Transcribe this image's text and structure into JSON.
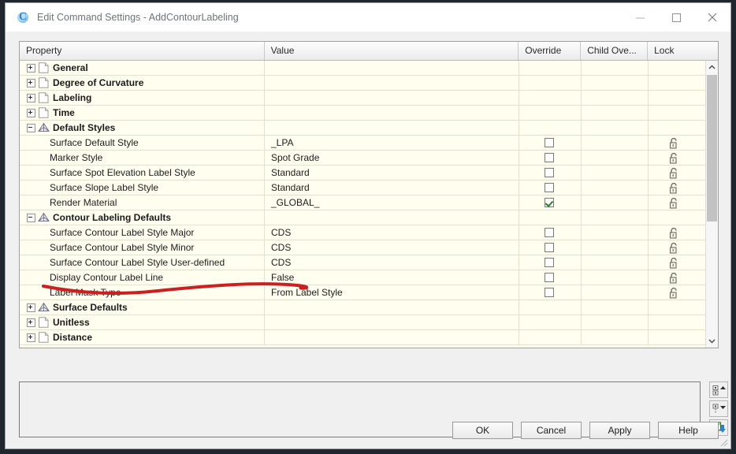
{
  "window": {
    "title": "Edit Command Settings - AddContourLabeling",
    "app_icon": "civil3d-icon",
    "minimize_label": "Minimize",
    "maximize_label": "Maximize",
    "close_label": "Close"
  },
  "grid": {
    "columns": [
      "Property",
      "Value",
      "Override",
      "Child Ove...",
      "Lock"
    ],
    "rows": [
      {
        "property": "General",
        "value": "",
        "type": "group",
        "expanded": false,
        "icon": "page-icon",
        "override": null,
        "lock": false
      },
      {
        "property": "Degree of Curvature",
        "value": "",
        "type": "group",
        "expanded": false,
        "icon": "page-icon",
        "override": null,
        "lock": false
      },
      {
        "property": "Labeling",
        "value": "",
        "type": "group",
        "expanded": false,
        "icon": "page-icon",
        "override": null,
        "lock": false
      },
      {
        "property": "Time",
        "value": "",
        "type": "group",
        "expanded": false,
        "icon": "page-icon",
        "override": null,
        "lock": false
      },
      {
        "property": "Default Styles",
        "value": "",
        "type": "group",
        "expanded": true,
        "icon": "surface-icon",
        "override": null,
        "lock": false
      },
      {
        "property": "Surface Default Style",
        "value": "_LPA",
        "type": "leaf",
        "override": false,
        "lock": true
      },
      {
        "property": "Marker Style",
        "value": "Spot Grade",
        "type": "leaf",
        "override": false,
        "lock": true
      },
      {
        "property": "Surface Spot Elevation Label Style",
        "value": "Standard",
        "type": "leaf",
        "override": false,
        "lock": true
      },
      {
        "property": "Surface Slope Label Style",
        "value": "Standard",
        "type": "leaf",
        "override": false,
        "lock": true
      },
      {
        "property": "Render Material",
        "value": "_GLOBAL_",
        "type": "leaf",
        "override": true,
        "lock": true
      },
      {
        "property": "Contour Labeling Defaults",
        "value": "",
        "type": "group",
        "expanded": true,
        "icon": "surface-icon",
        "override": null,
        "lock": false
      },
      {
        "property": "Surface Contour Label Style Major",
        "value": "CDS",
        "type": "leaf",
        "override": false,
        "lock": true
      },
      {
        "property": "Surface Contour Label Style Minor",
        "value": "CDS",
        "type": "leaf",
        "override": false,
        "lock": true
      },
      {
        "property": "Surface Contour Label Style User-defined",
        "value": "CDS",
        "type": "leaf",
        "override": false,
        "lock": true
      },
      {
        "property": "Display Contour Label Line",
        "value": "False",
        "type": "leaf",
        "override": false,
        "lock": true
      },
      {
        "property": "Label Mask Type",
        "value": "From Label Style",
        "type": "leaf",
        "override": false,
        "lock": true
      },
      {
        "property": "Surface Defaults",
        "value": "",
        "type": "group",
        "expanded": false,
        "icon": "surface-icon",
        "override": null,
        "lock": false
      },
      {
        "property": "Unitless",
        "value": "",
        "type": "group",
        "expanded": false,
        "icon": "page-icon",
        "override": null,
        "lock": false
      },
      {
        "property": "Distance",
        "value": "",
        "type": "group",
        "expanded": false,
        "icon": "page-icon",
        "override": null,
        "lock": false
      }
    ],
    "highlighted_row_property": "Display Contour Label Line",
    "annotation_color": "#cc2020"
  },
  "side_tools": [
    {
      "name": "expand-all-button",
      "icon": "expand-tree-icon"
    },
    {
      "name": "collapse-all-button",
      "icon": "collapse-tree-icon"
    },
    {
      "name": "override-toggle-button",
      "icon": "checkbox-down-arrow-icon"
    }
  ],
  "footer": {
    "buttons": [
      "OK",
      "Cancel",
      "Apply",
      "Help"
    ]
  },
  "description_panel": {
    "text": ""
  },
  "scrollbar": {
    "up_arrow": "chevron-up-icon",
    "down_arrow": "chevron-down-icon"
  }
}
